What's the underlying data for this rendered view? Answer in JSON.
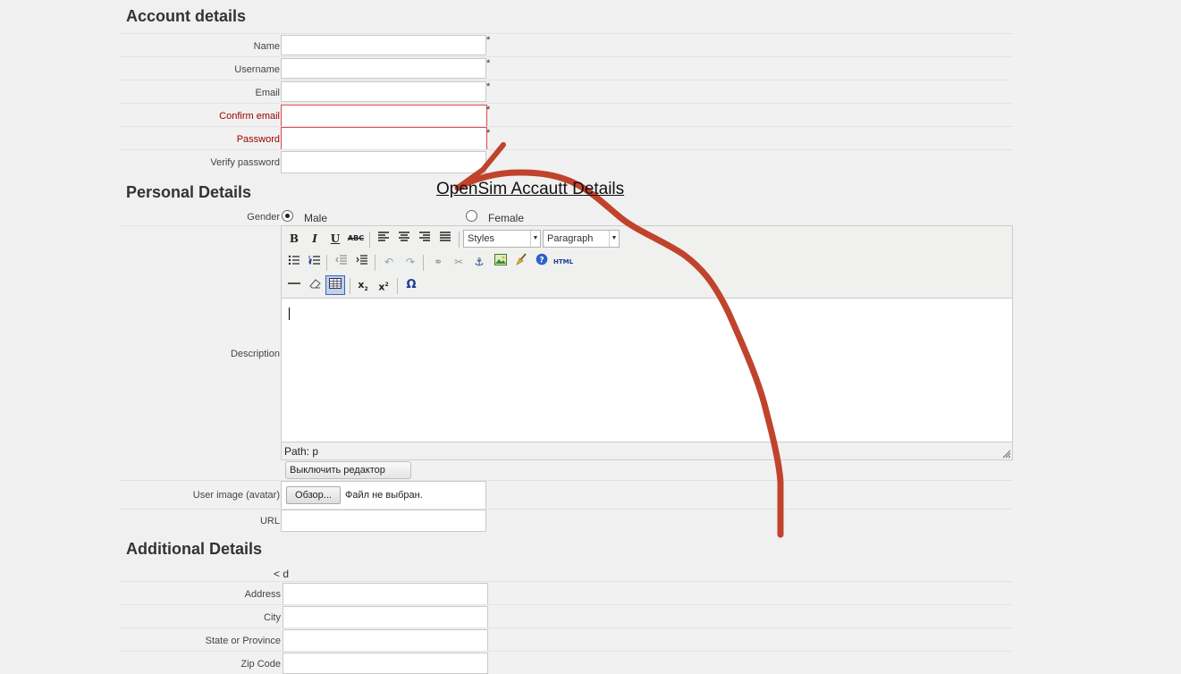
{
  "account": {
    "title": "Account details",
    "fields": [
      {
        "label": "Name",
        "required": "*"
      },
      {
        "label": "Username",
        "required": "*"
      },
      {
        "label": "Email",
        "required": "*"
      },
      {
        "label": "Confirm email",
        "required": "*"
      },
      {
        "label": "Password",
        "required": "*"
      },
      {
        "label": "Verify password",
        "required": ""
      }
    ]
  },
  "annotation": {
    "text": "OpenSim Accautt Details",
    "color": "#c0432c"
  },
  "personal": {
    "title": "Personal Details",
    "gender_label": "Gender",
    "gender_options": [
      "Male",
      "Female"
    ],
    "gender_selected": "Male",
    "description_label": "Description",
    "editor": {
      "styles_value": "Styles",
      "format_value": "Paragraph",
      "html_label": "HTML",
      "path_label": "Path: p",
      "toggle_button": "Выключить редактор"
    },
    "avatar_label": "User image (avatar)",
    "browse_button": "Обзор...",
    "file_status": "Файл не выбран.",
    "url_label": "URL"
  },
  "additional": {
    "title": "Additional Details",
    "stray_text": "< d",
    "fields": [
      "Address",
      "City",
      "State or Province",
      "Zip Code"
    ]
  },
  "colors": {
    "error": "#990000",
    "error_border": "#e24848",
    "annotation": "#c0432c"
  }
}
